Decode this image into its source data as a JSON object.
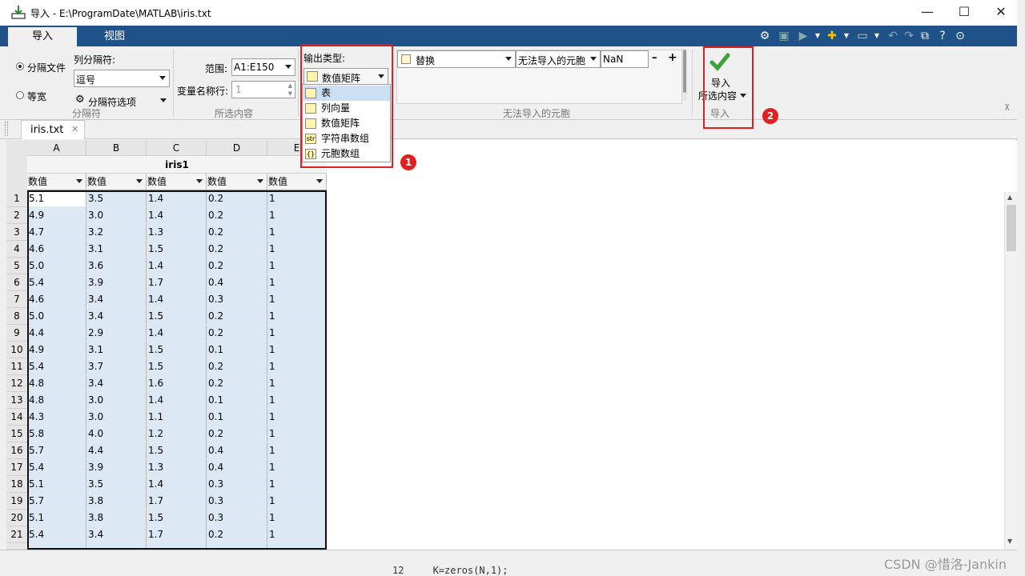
{
  "window": {
    "title": "导入 - E:\\ProgramDate\\MATLAB\\iris.txt",
    "minimize": "—",
    "maximize": "☐",
    "close": "✕"
  },
  "ribbon_tabs": [
    "导入",
    "视图"
  ],
  "delimited": {
    "radio_delimited": "分隔文件",
    "radio_fixed": "等宽",
    "col_delimiter_label": "列分隔符:",
    "col_delimiter_value": "逗号",
    "delimiter_options": "分隔符选项",
    "group_label": "分隔符"
  },
  "selection": {
    "range_label": "范围:",
    "range_value": "A1:E150",
    "varnames_label": "变量名称行:",
    "varnames_value": "1",
    "group_label": "所选内容"
  },
  "output": {
    "type_label": "输出类型:",
    "type_value": "数值矩阵",
    "options": [
      {
        "icon": "table-icon",
        "label": "表"
      },
      {
        "icon": "column-vector-icon",
        "label": "列向量"
      },
      {
        "icon": "numeric-matrix-icon",
        "label": "数值矩阵"
      },
      {
        "icon": "string-array-icon",
        "label": "字符串数组",
        "glyph": "str"
      },
      {
        "icon": "cell-array-icon",
        "label": "元胞数组",
        "glyph": "{}"
      }
    ]
  },
  "unimportable": {
    "rule_action": "替换",
    "rule_target": "无法导入的元胞",
    "rule_value": "NaN",
    "minus": "–",
    "plus": "+",
    "group_label": "无法导入的元胞"
  },
  "import": {
    "button_label": "导入",
    "button_sub": "所选内容",
    "group_label": "导入"
  },
  "annotations": {
    "badge1": "1",
    "badge2": "2"
  },
  "doc_tab": {
    "name": "iris.txt",
    "close": "✕"
  },
  "grid": {
    "variable_name": "iris1",
    "columns": [
      "A",
      "B",
      "C",
      "D",
      "E"
    ],
    "column_type": "数值",
    "rows": [
      [
        "5.1",
        "3.5",
        "1.4",
        "0.2",
        "1"
      ],
      [
        "4.9",
        "3.0",
        "1.4",
        "0.2",
        "1"
      ],
      [
        "4.7",
        "3.2",
        "1.3",
        "0.2",
        "1"
      ],
      [
        "4.6",
        "3.1",
        "1.5",
        "0.2",
        "1"
      ],
      [
        "5.0",
        "3.6",
        "1.4",
        "0.2",
        "1"
      ],
      [
        "5.4",
        "3.9",
        "1.7",
        "0.4",
        "1"
      ],
      [
        "4.6",
        "3.4",
        "1.4",
        "0.3",
        "1"
      ],
      [
        "5.0",
        "3.4",
        "1.5",
        "0.2",
        "1"
      ],
      [
        "4.4",
        "2.9",
        "1.4",
        "0.2",
        "1"
      ],
      [
        "4.9",
        "3.1",
        "1.5",
        "0.1",
        "1"
      ],
      [
        "5.4",
        "3.7",
        "1.5",
        "0.2",
        "1"
      ],
      [
        "4.8",
        "3.4",
        "1.6",
        "0.2",
        "1"
      ],
      [
        "4.8",
        "3.0",
        "1.4",
        "0.1",
        "1"
      ],
      [
        "4.3",
        "3.0",
        "1.1",
        "0.1",
        "1"
      ],
      [
        "5.8",
        "4.0",
        "1.2",
        "0.2",
        "1"
      ],
      [
        "5.7",
        "4.4",
        "1.5",
        "0.4",
        "1"
      ],
      [
        "5.4",
        "3.9",
        "1.3",
        "0.4",
        "1"
      ],
      [
        "5.1",
        "3.5",
        "1.4",
        "0.3",
        "1"
      ],
      [
        "5.7",
        "3.8",
        "1.7",
        "0.3",
        "1"
      ],
      [
        "5.1",
        "3.8",
        "1.5",
        "0.3",
        "1"
      ],
      [
        "5.4",
        "3.4",
        "1.7",
        "0.2",
        "1"
      ]
    ]
  },
  "background_code": "12     K=zeros(N,1);",
  "watermark": "CSDN @惜洛-Jankin"
}
